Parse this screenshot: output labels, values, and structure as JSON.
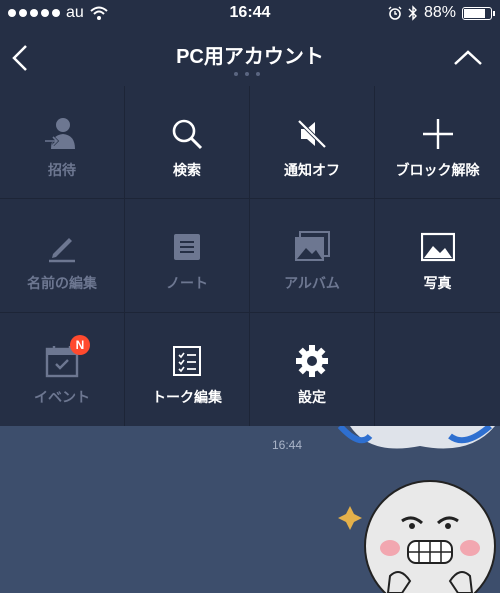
{
  "statusbar": {
    "carrier": "au",
    "time": "16:44",
    "battery_pct": "88%",
    "battery_level": 0.88
  },
  "header": {
    "title": "PC用アカウント",
    "back_icon": "chevron-left-icon",
    "collapse_icon": "chevron-up-icon"
  },
  "menu": {
    "items": [
      {
        "label": "招待",
        "icon": "invite-user-icon",
        "enabled": false
      },
      {
        "label": "検索",
        "icon": "search-icon",
        "enabled": true
      },
      {
        "label": "通知オフ",
        "icon": "mute-icon",
        "enabled": true
      },
      {
        "label": "ブロック解除",
        "icon": "plus-icon",
        "enabled": true
      },
      {
        "label": "名前の編集",
        "icon": "pencil-icon",
        "enabled": false
      },
      {
        "label": "ノート",
        "icon": "note-icon",
        "enabled": false
      },
      {
        "label": "アルバム",
        "icon": "album-icon",
        "enabled": false
      },
      {
        "label": "写真",
        "icon": "photo-icon",
        "enabled": true
      },
      {
        "label": "イベント",
        "icon": "calendar-icon",
        "enabled": false,
        "badge": "N"
      },
      {
        "label": "トーク編集",
        "icon": "checklist-icon",
        "enabled": true
      },
      {
        "label": "設定",
        "icon": "gear-icon",
        "enabled": true
      }
    ]
  },
  "chat": {
    "timestamp": "16:44"
  },
  "colors": {
    "panel_bg": "#252f45",
    "chat_bg": "#3d4e6c",
    "badge": "#ff4a2e",
    "disabled_text": "#6d7791"
  }
}
